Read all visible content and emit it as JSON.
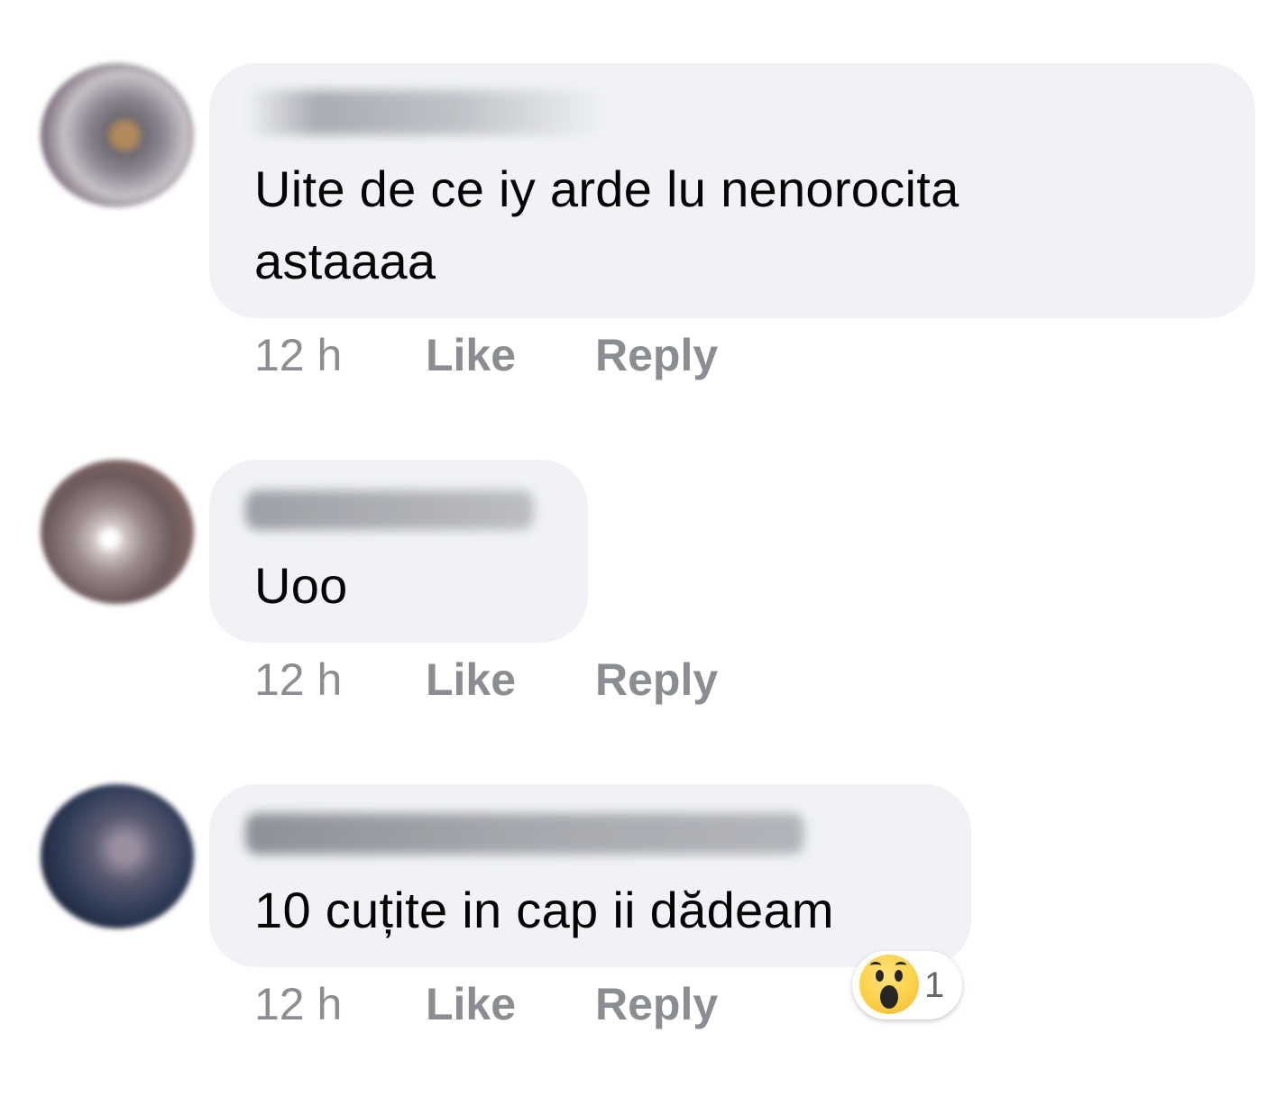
{
  "comments": [
    {
      "text_line1": "Uite de ce iy arde lu nenorocita",
      "text_line2": "astaaaa",
      "time": "12 h",
      "like_label": "Like",
      "reply_label": "Reply"
    },
    {
      "text_line1": "Uoo",
      "time": "12 h",
      "like_label": "Like",
      "reply_label": "Reply"
    },
    {
      "text_line1": "10 cuțite in cap ii dădeam",
      "time": "12 h",
      "like_label": "Like",
      "reply_label": "Reply",
      "reaction": {
        "icon": "wow-reaction-icon",
        "count": "1"
      }
    }
  ],
  "colors": {
    "bubble_background": "#f0f2f5",
    "text": "#050505",
    "meta_text": "#8a8d91",
    "wow_yellow": "#fcd149"
  }
}
